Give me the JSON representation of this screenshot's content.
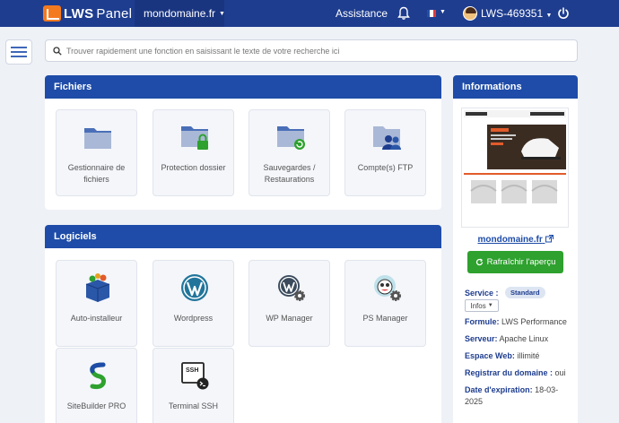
{
  "topbar": {
    "logo_lws": "LWS",
    "logo_panel": "Panel",
    "domain": "mondomaine.fr",
    "assistance": "Assistance",
    "user": "LWS-469351"
  },
  "search": {
    "placeholder": "Trouver rapidement une fonction en saisissant le texte de votre recherche ici"
  },
  "fichiers": {
    "title": "Fichiers",
    "tiles": [
      {
        "label": "Gestionnaire de fichiers",
        "icon": "folder-icon"
      },
      {
        "label": "Protection dossier",
        "icon": "folder-lock-icon"
      },
      {
        "label": "Sauvegardes / Restaurations",
        "icon": "folder-backup-icon"
      },
      {
        "label": "Compte(s) FTP",
        "icon": "folder-users-icon"
      }
    ]
  },
  "logiciels": {
    "title": "Logiciels",
    "tiles": [
      {
        "label": "Auto-installeur",
        "icon": "box-icon"
      },
      {
        "label": "Wordpress",
        "icon": "wordpress-icon"
      },
      {
        "label": "WP Manager",
        "icon": "wordpress-gear-icon"
      },
      {
        "label": "PS Manager",
        "icon": "prestashop-gear-icon"
      },
      {
        "label": "SiteBuilder PRO",
        "icon": "sitebuilder-icon"
      },
      {
        "label": "Terminal SSH",
        "icon": "ssh-terminal-icon"
      }
    ]
  },
  "info": {
    "title": "Informations",
    "site_link": "mondomaine.fr",
    "refresh_label": "Rafraîchir l'aperçu",
    "service_label": "Service :",
    "service_badge": "Standard",
    "infos_btn": "Infos",
    "rows": [
      {
        "label": "Formule:",
        "value": " LWS Performance"
      },
      {
        "label": "Serveur:",
        "value": " Apache Linux"
      },
      {
        "label": "Espace Web:",
        "value": " illimité"
      },
      {
        "label": "Registrar du domaine :",
        "value": " oui"
      },
      {
        "label": "Date d'expiration:",
        "value": " 18-03-"
      }
    ],
    "expiry_year": "2025"
  },
  "colors": {
    "topbar": "#1e3d8f",
    "panel_head": "#1e4ca8",
    "refresh": "#2ea12e",
    "logo_accent": "#f47a20"
  }
}
